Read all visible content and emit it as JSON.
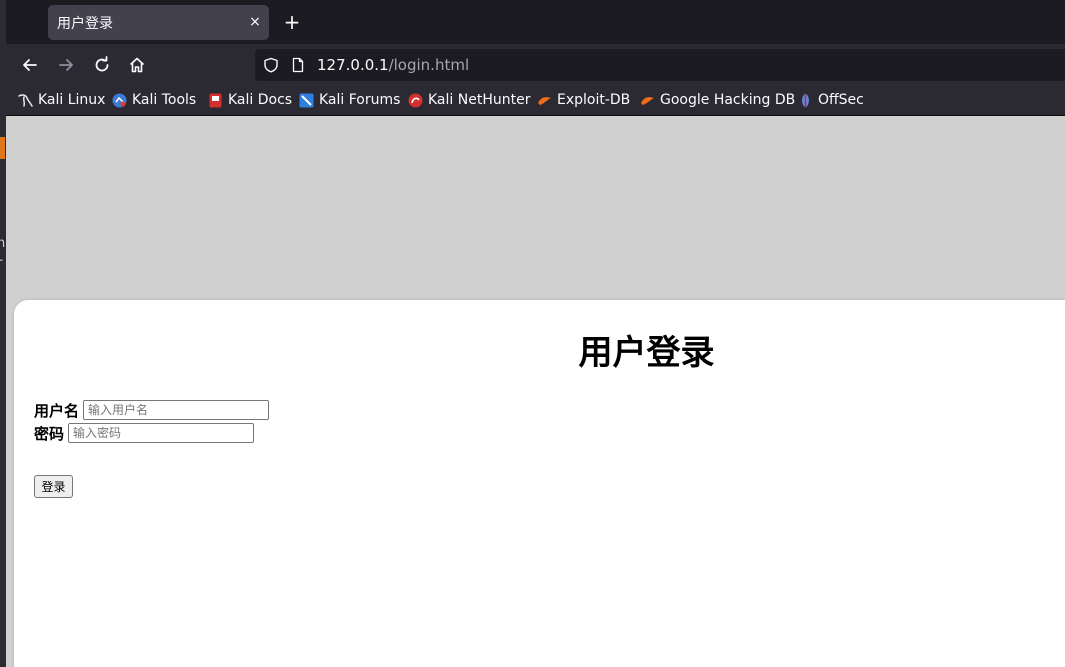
{
  "browser": {
    "tab": {
      "title": "用户登录",
      "close_glyph": "×"
    },
    "new_tab_glyph": "+",
    "url": {
      "host": "127.0.0.1",
      "path": "/login.html"
    },
    "bookmarks": [
      {
        "label": "Kali Linux",
        "icon": "kali-dragon-icon"
      },
      {
        "label": "Kali Tools",
        "icon": "kali-tools-icon"
      },
      {
        "label": "Kali Docs",
        "icon": "kali-docs-icon"
      },
      {
        "label": "Kali Forums",
        "icon": "kali-forums-icon"
      },
      {
        "label": "Kali NetHunter",
        "icon": "kali-nethunter-icon"
      },
      {
        "label": "Exploit-DB",
        "icon": "exploit-db-icon"
      },
      {
        "label": "Google Hacking DB",
        "icon": "google-hacking-db-icon"
      },
      {
        "label": "OffSec",
        "icon": "offsec-icon"
      }
    ]
  },
  "page": {
    "title": "用户登录",
    "username": {
      "label": "用户名",
      "placeholder": "输入用户名",
      "value": ""
    },
    "password": {
      "label": "密码",
      "placeholder": "输入密码",
      "value": ""
    },
    "submit_label": "登录"
  },
  "desktop": {
    "edge_glyphs": [
      "n",
      "r"
    ]
  },
  "colors": {
    "tabstrip_bg": "#1c1b22",
    "toolbar_bg": "#2b2a33",
    "active_tab_bg": "#42414d",
    "page_bg": "#d0d0d0",
    "card_bg": "#ffffff",
    "accent_orange": "#e0761a"
  }
}
